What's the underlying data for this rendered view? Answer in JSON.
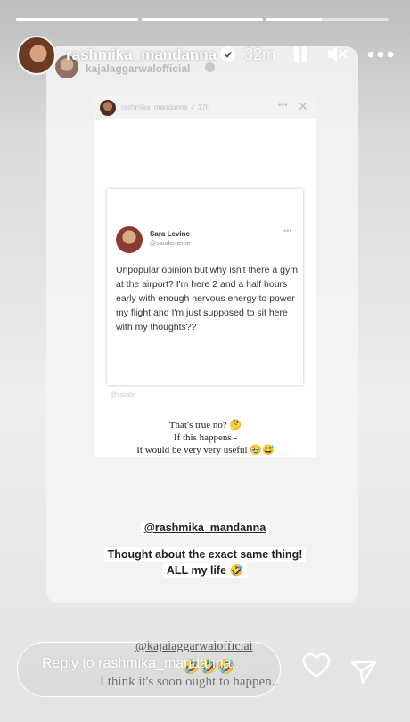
{
  "story": {
    "progress": [
      {
        "fill_pct": 100
      },
      {
        "fill_pct": 100
      },
      {
        "fill_pct": 45
      }
    ]
  },
  "header": {
    "username": "rashmika_mandanna",
    "time_ago": "32m",
    "icons": [
      "verified-badge-icon",
      "pause-icon",
      "mute-icon",
      "more-icon"
    ]
  },
  "reshared_story": {
    "username": "kajalaggarwalofficial"
  },
  "repost": {
    "username": "rashmika_mandanna",
    "time": "17h",
    "tweet": {
      "name": "Sara Levine",
      "handle": "@saralememe",
      "text": "Unpopular opinion but why isn't there a gym at the airport? I'm here 2 and a half hours early with enough nervous energy to power my flight and I'm just supposed to sit here with my thoughts??"
    },
    "watermark": "@ssliabs",
    "caption": {
      "line1": "That's true no? 🤔",
      "line2": "If this happens -",
      "line3": "It would be very very useful 🥹😅"
    }
  },
  "overlay": {
    "mention": "@rashmika_mandanna",
    "quote_line1": "Thought about the exact same thing!",
    "quote_line2": "ALL my life 🤣"
  },
  "footer_sticker": {
    "mention": "@kajalaggarwalofficial",
    "emojis": "🤣🤣🤣",
    "text": "I think it's soon ought to happen.."
  },
  "reply": {
    "placeholder": "Reply to rashmika_mandanna..."
  },
  "colors": {
    "accent": "#ffffff",
    "emoji_yellow": "#f3c02c"
  }
}
